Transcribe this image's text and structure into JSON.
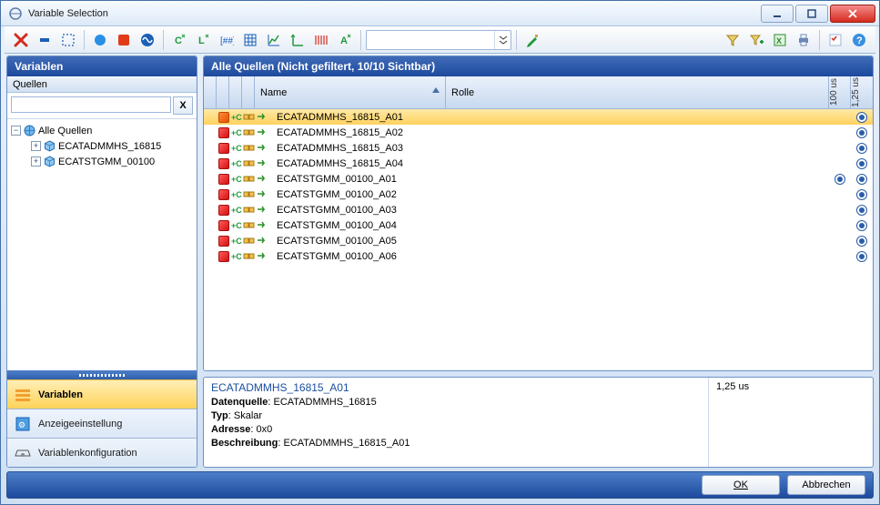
{
  "window": {
    "title": "Variable Selection"
  },
  "toolbar": {
    "icons": [
      "close-x",
      "dash",
      "select-rect",
      "circle",
      "square",
      "sine",
      "c-badge",
      "l-badge",
      "bracket-num",
      "grid",
      "chart-up",
      "axis-up",
      "bars",
      "a-badge"
    ],
    "icons_right": [
      "funnel",
      "funnel-plus",
      "excel",
      "printer",
      "checklist",
      "help"
    ],
    "combo_value": "",
    "pen": "pen"
  },
  "left": {
    "header": "Variablen",
    "sources_label": "Quellen",
    "search_value": "",
    "search_clear": "X",
    "tree": {
      "root": "Alle Quellen",
      "children": [
        "ECATADMMHS_16815",
        "ECATSTGMM_00100"
      ]
    },
    "nav": [
      {
        "label": "Variablen",
        "active": true
      },
      {
        "label": "Anzeigeeinstellung",
        "active": false
      },
      {
        "label": "Variablenkonfiguration",
        "active": false
      }
    ]
  },
  "grid": {
    "header": "Alle Quellen (Nicht gefiltert, 10/10 Sichtbar)",
    "columns": {
      "name": "Name",
      "role": "Rolle",
      "col_a": "100 us",
      "col_b": "1,25 us"
    },
    "rows": [
      {
        "name": "ECATADMMHS_16815_A01",
        "sel": true,
        "a": false,
        "b": true
      },
      {
        "name": "ECATADMMHS_16815_A02",
        "sel": false,
        "a": false,
        "b": true
      },
      {
        "name": "ECATADMMHS_16815_A03",
        "sel": false,
        "a": false,
        "b": true
      },
      {
        "name": "ECATADMMHS_16815_A04",
        "sel": false,
        "a": false,
        "b": true
      },
      {
        "name": "ECATSTGMM_00100_A01",
        "sel": false,
        "a": true,
        "b": true
      },
      {
        "name": "ECATSTGMM_00100_A02",
        "sel": false,
        "a": false,
        "b": true
      },
      {
        "name": "ECATSTGMM_00100_A03",
        "sel": false,
        "a": false,
        "b": true
      },
      {
        "name": "ECATSTGMM_00100_A04",
        "sel": false,
        "a": false,
        "b": true
      },
      {
        "name": "ECATSTGMM_00100_A05",
        "sel": false,
        "a": false,
        "b": true
      },
      {
        "name": "ECATSTGMM_00100_A06",
        "sel": false,
        "a": false,
        "b": true
      }
    ]
  },
  "detail": {
    "title": "ECATADMMHS_16815_A01",
    "labels": {
      "datasource": "Datenquelle",
      "type": "Typ",
      "address": "Adresse",
      "description": "Beschreibung"
    },
    "values": {
      "datasource": "ECATADMMHS_16815",
      "type": "Skalar",
      "address": "0x0",
      "description": "ECATADMMHS_16815_A01"
    },
    "right": "1,25 us"
  },
  "footer": {
    "ok": "OK",
    "cancel": "Abbrechen"
  }
}
